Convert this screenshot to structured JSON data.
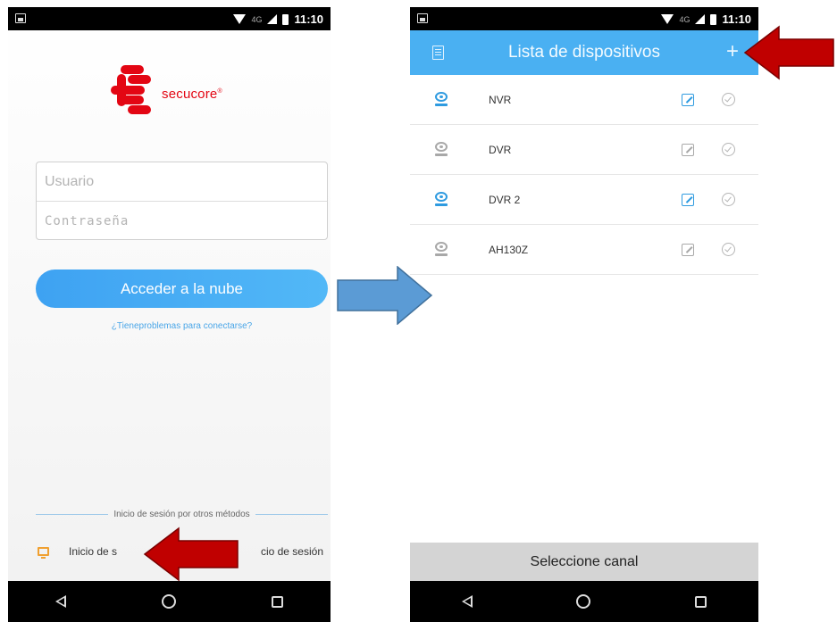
{
  "colors": {
    "accent": "#4ab0f2",
    "brand_red": "#e30613",
    "annotation_red": "#c00000",
    "annotation_blue": "#5b9bd5",
    "icon_online": "#2f9be0",
    "icon_offline": "#a8a8a8"
  },
  "status_bar": {
    "network": "4G",
    "time": "11:10"
  },
  "login_screen": {
    "logo_text": "secucore",
    "logo_mark": "®",
    "username_placeholder": "Usuario",
    "password_placeholder": "Contraseña",
    "cloud_button_label": "Acceder a la nube",
    "trouble_link": "¿Tieneproblemas para conectarse?",
    "other_methods_label": "Inicio de sesión por otros métodos",
    "alt_login_left": "Inicio de s",
    "alt_login_right": "cio de sesión"
  },
  "device_screen": {
    "title": "Lista de dispositivos",
    "add_icon": "+",
    "devices": [
      {
        "name": "NVR",
        "status": "online"
      },
      {
        "name": "DVR",
        "status": "offline"
      },
      {
        "name": "DVR 2",
        "status": "online"
      },
      {
        "name": "AH130Z",
        "status": "offline"
      }
    ],
    "select_channel_label": "Seleccione canal"
  },
  "icons": {
    "notification": "image-notification-icon",
    "wifi": "wifi-icon",
    "signal": "signal-icon",
    "battery": "battery-icon",
    "menu": "list-icon",
    "add": "plus-icon",
    "device": "camera-icon",
    "edit": "edit-icon",
    "select": "check-circle-icon",
    "alt_login": "monitor-icon"
  }
}
